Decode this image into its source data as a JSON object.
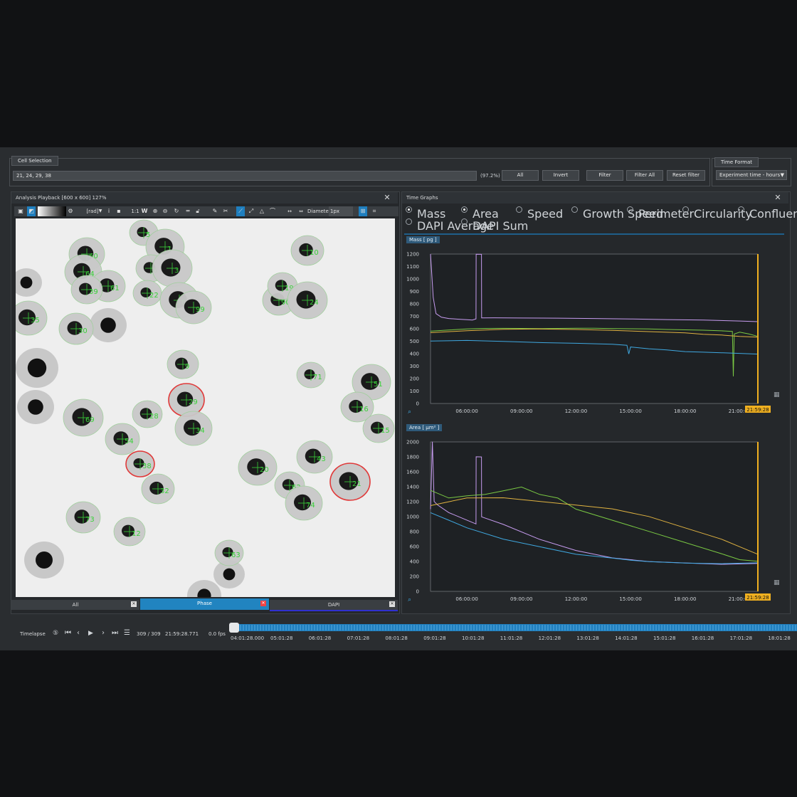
{
  "cell_selection": {
    "label": "Cell Selection",
    "value": "21, 24, 29, 38",
    "percent": "(97.2%)",
    "buttons": {
      "all": "All",
      "invert": "Invert",
      "filter": "Filter",
      "filter_all": "Filter All",
      "reset_filter": "Reset filter"
    }
  },
  "time_format": {
    "label": "Time Format",
    "value": "Experiment time - hours"
  },
  "playback": {
    "title": "Analysis Playback [600 x 600] 127%",
    "toolbar": {
      "zoom_ratio": "1:1",
      "unit": "[rad]",
      "diameter_label": "Diameter:",
      "diameter_value": "1px"
    },
    "tabs": [
      "All",
      "Phase",
      "DAPI"
    ],
    "cells": [
      {
        "id": "5",
        "color": "green"
      },
      {
        "id": "1",
        "color": "green"
      },
      {
        "id": "60",
        "color": "green"
      },
      {
        "id": "10",
        "color": "green"
      },
      {
        "id": "6",
        "color": "green"
      },
      {
        "id": "3",
        "color": "green"
      },
      {
        "id": "64",
        "color": "green"
      },
      {
        "id": "61",
        "color": "green"
      },
      {
        "id": "39",
        "color": "green"
      },
      {
        "id": "22",
        "color": "green"
      },
      {
        "id": "8",
        "color": "green"
      },
      {
        "id": "99",
        "color": "green"
      },
      {
        "id": "90",
        "color": "green"
      },
      {
        "id": "19",
        "color": "green"
      },
      {
        "id": "24",
        "color": "green"
      },
      {
        "id": "35",
        "color": "green"
      },
      {
        "id": "30",
        "color": "green"
      },
      {
        "id": "9",
        "color": "green"
      },
      {
        "id": "71",
        "color": "green"
      },
      {
        "id": "51",
        "color": "green"
      },
      {
        "id": "29",
        "color": "red"
      },
      {
        "id": "16",
        "color": "green"
      },
      {
        "id": "28",
        "color": "green"
      },
      {
        "id": "69",
        "color": "green"
      },
      {
        "id": "34",
        "color": "green"
      },
      {
        "id": "54",
        "color": "green"
      },
      {
        "id": "15",
        "color": "green"
      },
      {
        "id": "38",
        "color": "red"
      },
      {
        "id": "20",
        "color": "green"
      },
      {
        "id": "43",
        "color": "green"
      },
      {
        "id": "32",
        "color": "green"
      },
      {
        "id": "62",
        "color": "green"
      },
      {
        "id": "21",
        "color": "red"
      },
      {
        "id": "74",
        "color": "green"
      },
      {
        "id": "73",
        "color": "green"
      },
      {
        "id": "12",
        "color": "green"
      },
      {
        "id": "63",
        "color": "green"
      }
    ]
  },
  "time_graphs": {
    "title": "Time Graphs",
    "radios": [
      {
        "label": "Mass",
        "selected": true
      },
      {
        "label": "Area",
        "selected": true
      },
      {
        "label": "Speed",
        "selected": false
      },
      {
        "label": "Growth Speed",
        "selected": false
      },
      {
        "label": "Perimeter",
        "selected": false
      },
      {
        "label": "Circularity",
        "selected": false
      },
      {
        "label": "Confluence",
        "selected": false
      },
      {
        "label": "DAPI Average",
        "selected": false
      },
      {
        "label": "DAPI Sum",
        "selected": false
      }
    ],
    "current_time": "21:59:28"
  },
  "chart_data": [
    {
      "type": "line",
      "title": "Mass [ pg ]",
      "x_ticks": [
        "06:00:00",
        "09:00:00",
        "12:00:00",
        "15:00:00",
        "18:00:00",
        "21:00:00"
      ],
      "ylim": [
        0,
        1200
      ],
      "y_ticks": [
        0,
        100,
        200,
        300,
        400,
        500,
        600,
        700,
        800,
        900,
        1000,
        1100,
        1200
      ],
      "x_range_hours": [
        4.0,
        22.0
      ],
      "series": [
        {
          "color": "#c79cf0",
          "x": [
            4.0,
            4.15,
            4.3,
            4.6,
            5.0,
            5.5,
            6.0,
            6.3,
            6.5,
            6.51,
            6.8,
            6.81,
            7.5,
            9,
            11,
            13,
            15,
            17,
            19,
            21,
            22.0
          ],
          "values": [
            1200,
            850,
            720,
            690,
            680,
            675,
            672,
            670,
            680,
            1200,
            1200,
            690,
            690,
            688,
            686,
            682,
            678,
            672,
            668,
            660,
            655
          ]
        },
        {
          "color": "#7ac943",
          "x": [
            4.0,
            5,
            6,
            7,
            8,
            9,
            10,
            11,
            12,
            13,
            14,
            15,
            16,
            17,
            18,
            19,
            20,
            20.6,
            20.65,
            20.7,
            21,
            21.5,
            22.0
          ],
          "values": [
            580,
            590,
            600,
            605,
            606,
            605,
            603,
            604,
            605,
            603,
            600,
            598,
            596,
            592,
            590,
            588,
            584,
            580,
            220,
            560,
            575,
            560,
            540
          ]
        },
        {
          "color": "#e0b341",
          "x": [
            4.0,
            6,
            8,
            10,
            12,
            14,
            16,
            18,
            19,
            20,
            21,
            22.0
          ],
          "values": [
            570,
            585,
            595,
            597,
            592,
            585,
            575,
            565,
            555,
            550,
            540,
            535
          ]
        },
        {
          "color": "#3fa8e0",
          "x": [
            4.0,
            6,
            8,
            10,
            12,
            14,
            14.8,
            14.9,
            15.0,
            16,
            17,
            18,
            19,
            20,
            21,
            22.0
          ],
          "values": [
            500,
            505,
            498,
            490,
            485,
            478,
            470,
            400,
            455,
            440,
            430,
            415,
            410,
            405,
            400,
            395
          ]
        }
      ]
    },
    {
      "type": "line",
      "title": "Area [ μm² ]",
      "x_ticks": [
        "06:00:00",
        "09:00:00",
        "12:00:00",
        "15:00:00",
        "18:00:00",
        "21:00:00"
      ],
      "ylim": [
        0,
        2000
      ],
      "y_ticks": [
        0,
        200,
        400,
        600,
        800,
        1000,
        1200,
        1400,
        1600,
        1800,
        2000
      ],
      "x_range_hours": [
        4.0,
        22.0
      ],
      "series": [
        {
          "color": "#c79cf0",
          "x": [
            4.0,
            4.1,
            4.2,
            4.4,
            5,
            6,
            6.5,
            6.51,
            6.8,
            6.81,
            8,
            10,
            12,
            14,
            16,
            18,
            20,
            22.0
          ],
          "values": [
            1100,
            2000,
            1200,
            1150,
            1050,
            950,
            900,
            1800,
            1800,
            1000,
            900,
            700,
            550,
            450,
            400,
            380,
            360,
            370
          ]
        },
        {
          "color": "#7ac943",
          "x": [
            4.0,
            5,
            6,
            7,
            8,
            9,
            10,
            11,
            12,
            14,
            16,
            18,
            20,
            21,
            22.0
          ],
          "values": [
            1350,
            1250,
            1280,
            1300,
            1350,
            1400,
            1300,
            1250,
            1100,
            950,
            800,
            650,
            500,
            420,
            400
          ]
        },
        {
          "color": "#e0b341",
          "x": [
            4.0,
            5,
            6,
            8,
            10,
            12,
            14,
            15,
            16,
            18,
            20,
            21,
            22.0
          ],
          "values": [
            1150,
            1200,
            1250,
            1250,
            1200,
            1150,
            1100,
            1050,
            1000,
            850,
            700,
            600,
            500
          ]
        },
        {
          "color": "#3fa8e0",
          "x": [
            4.0,
            5,
            6,
            8,
            10,
            12,
            14,
            15,
            16,
            18,
            20,
            22.0
          ],
          "values": [
            1050,
            950,
            850,
            700,
            600,
            500,
            450,
            420,
            400,
            380,
            370,
            380
          ]
        }
      ]
    }
  ],
  "timelapse": {
    "label": "Timelapse",
    "frame": "309 / 309",
    "time": "21:59:28.771",
    "fps": "0.0 fps",
    "ticks": [
      "04:01:28.000",
      "05:01:28",
      "06:01:28",
      "07:01:28",
      "08:01:28",
      "09:01:28",
      "10:01:28",
      "11:01:28",
      "12:01:28",
      "13:01:28",
      "14:01:28",
      "15:01:28",
      "16:01:28",
      "17:01:28",
      "18:01:28"
    ]
  },
  "colors": {
    "accent": "#1f7fbf",
    "highlight": "#f0b020",
    "background": "#2a2d30"
  }
}
